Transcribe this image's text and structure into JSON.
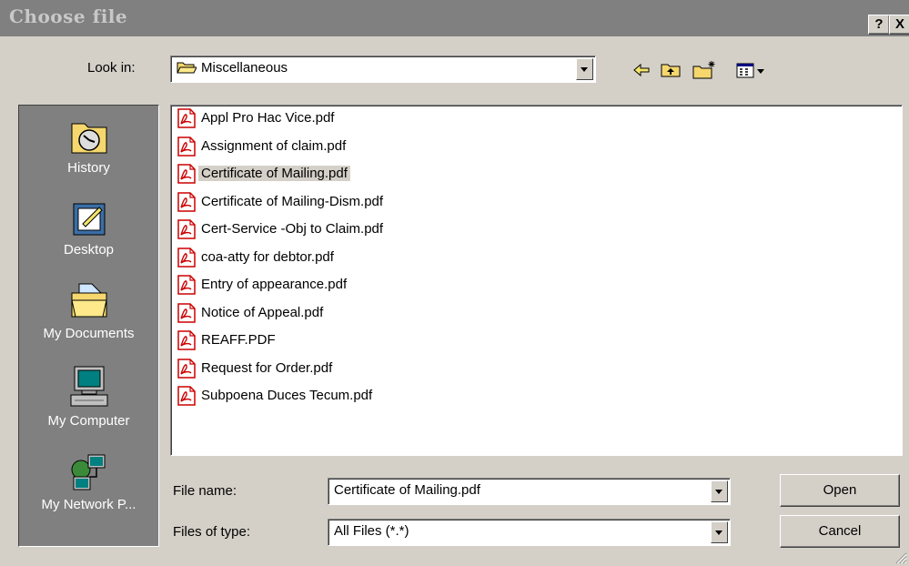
{
  "window": {
    "title": "Choose file",
    "help_button": "?",
    "close_button": "X"
  },
  "look_in": {
    "label": "Look in:",
    "value": "Miscellaneous",
    "toolbar_icons": [
      "back-arrow-icon",
      "up-folder-icon",
      "new-folder-icon",
      "view-menu-icon"
    ]
  },
  "places": [
    {
      "label": "History",
      "icon": "history-icon"
    },
    {
      "label": "Desktop",
      "icon": "desktop-icon"
    },
    {
      "label": "My Documents",
      "icon": "my-documents-icon"
    },
    {
      "label": "My Computer",
      "icon": "my-computer-icon"
    },
    {
      "label": "My Network P...",
      "icon": "my-network-places-icon"
    }
  ],
  "files": [
    {
      "name": "Appl Pro Hac Vice.pdf",
      "selected": false
    },
    {
      "name": "Assignment of claim.pdf",
      "selected": false
    },
    {
      "name": "Certificate of Mailing.pdf",
      "selected": true
    },
    {
      "name": "Certificate of Mailing-Dism.pdf",
      "selected": false
    },
    {
      "name": "Cert-Service -Obj to Claim.pdf",
      "selected": false
    },
    {
      "name": "coa-atty for debtor.pdf",
      "selected": false
    },
    {
      "name": "Entry of appearance.pdf",
      "selected": false
    },
    {
      "name": "Notice of Appeal.pdf",
      "selected": false
    },
    {
      "name": "REAFF.PDF",
      "selected": false
    },
    {
      "name": "Request for Order.pdf",
      "selected": false
    },
    {
      "name": "Subpoena Duces Tecum.pdf",
      "selected": false
    }
  ],
  "file_name": {
    "label": "File name:",
    "value": "Certificate of Mailing.pdf"
  },
  "file_type": {
    "label": "Files of type:",
    "value": "All Files (*.*)"
  },
  "buttons": {
    "open": "Open",
    "cancel": "Cancel"
  },
  "colors": {
    "dialog_bg": "#d4d0c8",
    "titlebar_bg": "#808080",
    "places_bg": "#808080",
    "pdf_icon_red": "#cc0000"
  }
}
